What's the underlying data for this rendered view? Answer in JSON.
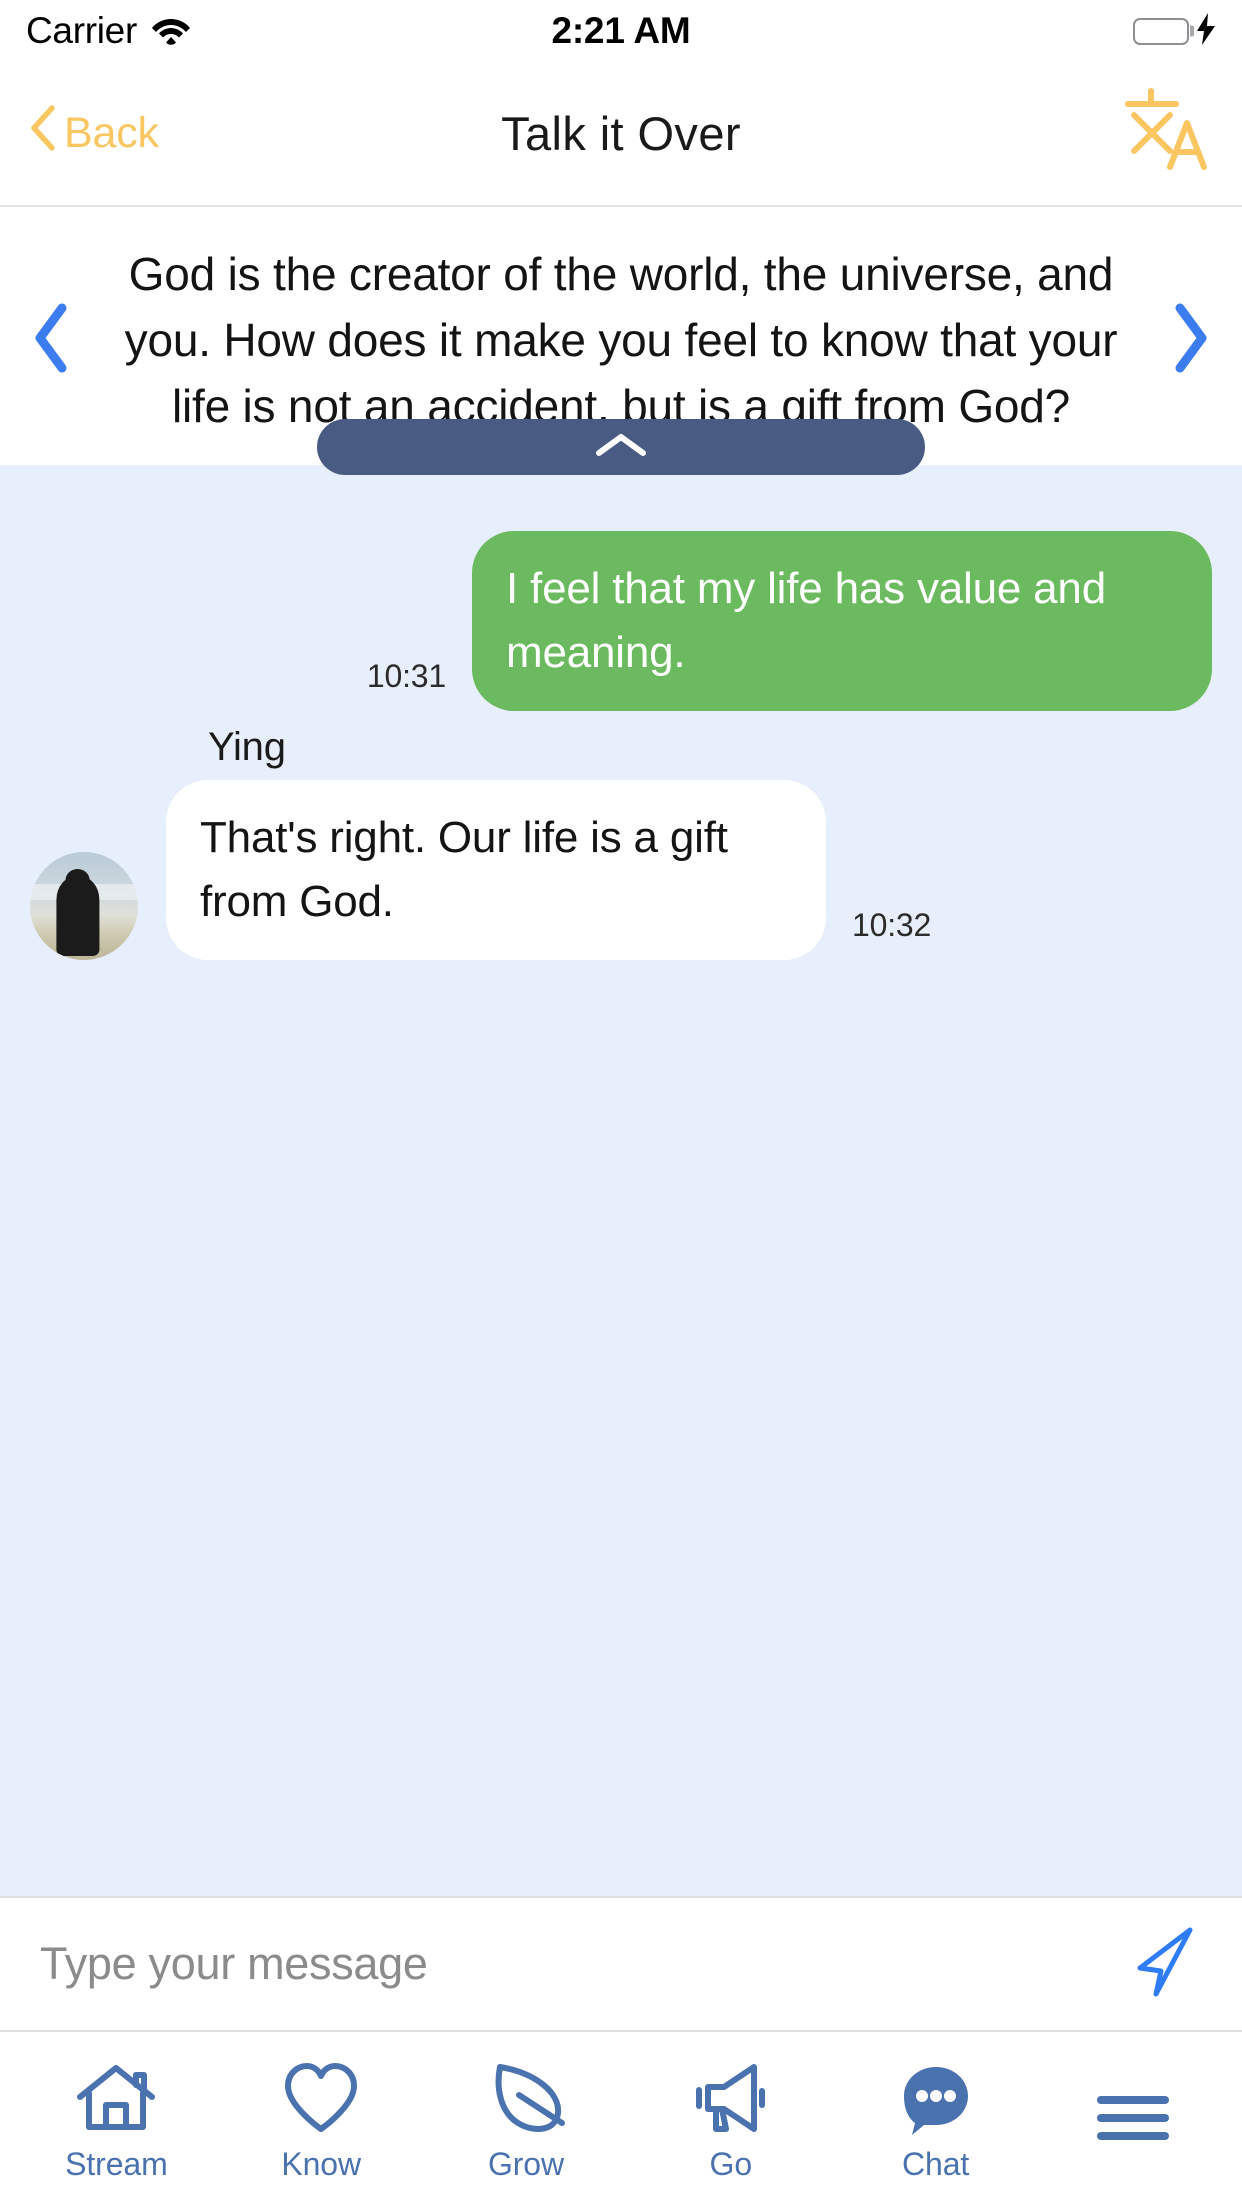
{
  "status_bar": {
    "carrier": "Carrier",
    "wifi_icon": "wifi-icon",
    "time": "2:21 AM",
    "battery_icon": "battery-full-icon",
    "charging_icon": "lightning-bolt-icon",
    "battery_color": "#4CD964"
  },
  "nav_bar": {
    "back_label": "Back",
    "back_chevron_icon": "chevron-left-icon",
    "title": "Talk it Over",
    "translate_icon": "translate-icon",
    "accent_color": "#F9C662"
  },
  "question_panel": {
    "prev_icon": "chevron-left-icon",
    "next_icon": "chevron-right-icon",
    "arrow_color": "#3B7DEF",
    "text": "God is the creator of the world, the universe, and you. How does it make you feel to know that your life is not an accident, but is a gift from God?"
  },
  "collapse_handle": {
    "icon": "chevron-up-icon",
    "color": "#4A5B83"
  },
  "chat": {
    "background_color": "#E8EFFC",
    "outgoing_bubble_color": "#6CBA5F",
    "incoming_bubble_color": "#FFFFFF",
    "messages": [
      {
        "direction": "outgoing",
        "text": "I feel that my life has value and meaning.",
        "time": "10:31"
      },
      {
        "direction": "incoming",
        "sender": "Ying",
        "avatar_icon": "person-silhouette-avatar",
        "text": "That's right. Our life is a gift from God.",
        "time": "10:32"
      }
    ]
  },
  "input_bar": {
    "placeholder": "Type your message",
    "value": "",
    "send_icon": "send-paper-plane-icon",
    "send_color": "#2E7CF6"
  },
  "tab_bar": {
    "color": "#4A72AE",
    "active_tab": "Chat",
    "tabs": [
      {
        "label": "Stream",
        "icon": "home-icon"
      },
      {
        "label": "Know",
        "icon": "heart-icon"
      },
      {
        "label": "Grow",
        "icon": "leaf-icon"
      },
      {
        "label": "Go",
        "icon": "megaphone-icon"
      },
      {
        "label": "Chat",
        "icon": "chat-bubble-dots-icon"
      }
    ],
    "menu_icon": "hamburger-menu-icon"
  }
}
